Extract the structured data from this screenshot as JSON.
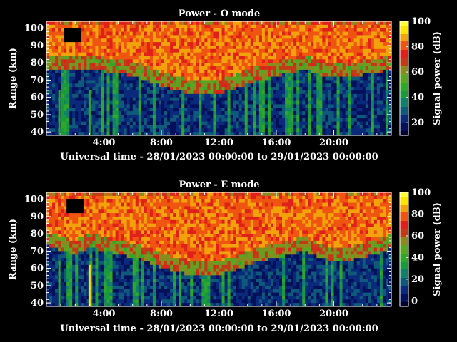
{
  "figure": {
    "colormap": [
      "#000030",
      "#05105a",
      "#0b2a7c",
      "#0f5a7a",
      "#12806a",
      "#1a9a3c",
      "#2fa82a",
      "#5aa522",
      "#8a8a1e",
      "#c23b18",
      "#e0201a",
      "#ef5510",
      "#f2a20a",
      "#ffe400",
      "#ffff30"
    ]
  },
  "chart_data": [
    {
      "type": "heatmap",
      "title": "Power - O mode",
      "xlabel": "Universal time - 28/01/2023 00:00:00 to 29/01/2023 00:00:00",
      "ylabel": "Range (km)",
      "x_ticks": [
        "4:00",
        "8:00",
        "12:00",
        "16:00",
        "20:00"
      ],
      "x_tick_hours": [
        4,
        8,
        12,
        16,
        20
      ],
      "xlim_hours": [
        0,
        24
      ],
      "y_ticks": [
        100,
        90,
        80,
        70,
        60,
        50,
        40
      ],
      "ylim": [
        38,
        104
      ],
      "colorbar": {
        "label": "Signal power (dB)",
        "ticks": [
          100,
          80,
          60,
          40,
          20
        ],
        "range": [
          10,
          100
        ]
      },
      "lower_edge_profile": {
        "hours": [
          0,
          1,
          2,
          3,
          4,
          5,
          6,
          7,
          8,
          9,
          10,
          11,
          12,
          13,
          14,
          15,
          16,
          17,
          18,
          19,
          20,
          21,
          22,
          23,
          24
        ],
        "range_km": [
          76,
          75,
          75,
          77,
          75,
          74,
          72,
          70,
          66,
          64,
          62,
          62,
          62,
          64,
          68,
          70,
          72,
          74,
          76,
          73,
          72,
          72,
          73,
          74,
          76
        ]
      },
      "black_gap": {
        "hour_range": [
          1.3,
          2.4
        ],
        "range_km": [
          93,
          100
        ]
      },
      "vertical_bands": [
        {
          "hour": 3.0,
          "color": "#2fa82a"
        },
        {
          "hour": 0.9,
          "color": "#2fa82a"
        }
      ]
    },
    {
      "type": "heatmap",
      "title": "Power - E mode",
      "xlabel": "Universal time - 28/01/2023 00:00:00 to 29/01/2023 00:00:00",
      "ylabel": "Range (km)",
      "x_ticks": [
        "4:00",
        "8:00",
        "12:00",
        "16:00",
        "20:00"
      ],
      "x_tick_hours": [
        4,
        8,
        12,
        16,
        20
      ],
      "xlim_hours": [
        0,
        24
      ],
      "y_ticks": [
        100,
        90,
        80,
        70,
        60,
        50,
        40
      ],
      "ylim": [
        38,
        104
      ],
      "colorbar": {
        "label": "Signal power (dB)",
        "ticks": [
          100,
          80,
          60,
          40,
          20,
          0
        ],
        "range": [
          -5,
          100
        ]
      },
      "lower_edge_profile": {
        "hours": [
          0,
          1,
          2,
          3,
          4,
          5,
          6,
          7,
          8,
          9,
          10,
          11,
          12,
          13,
          14,
          15,
          16,
          17,
          18,
          19,
          20,
          21,
          22,
          23,
          24
        ],
        "range_km": [
          74,
          70,
          68,
          72,
          70,
          68,
          66,
          64,
          60,
          58,
          56,
          56,
          56,
          58,
          62,
          64,
          66,
          68,
          70,
          66,
          64,
          64,
          66,
          68,
          72
        ]
      },
      "black_gap": {
        "hour_range": [
          1.5,
          2.5
        ],
        "range_km": [
          92,
          100
        ]
      },
      "vertical_bands": [
        {
          "hour": 3.0,
          "color": "#ffe400",
          "range_km": [
            38,
            62
          ]
        },
        {
          "hour": 0.9,
          "color": "#2fa82a"
        }
      ]
    }
  ]
}
